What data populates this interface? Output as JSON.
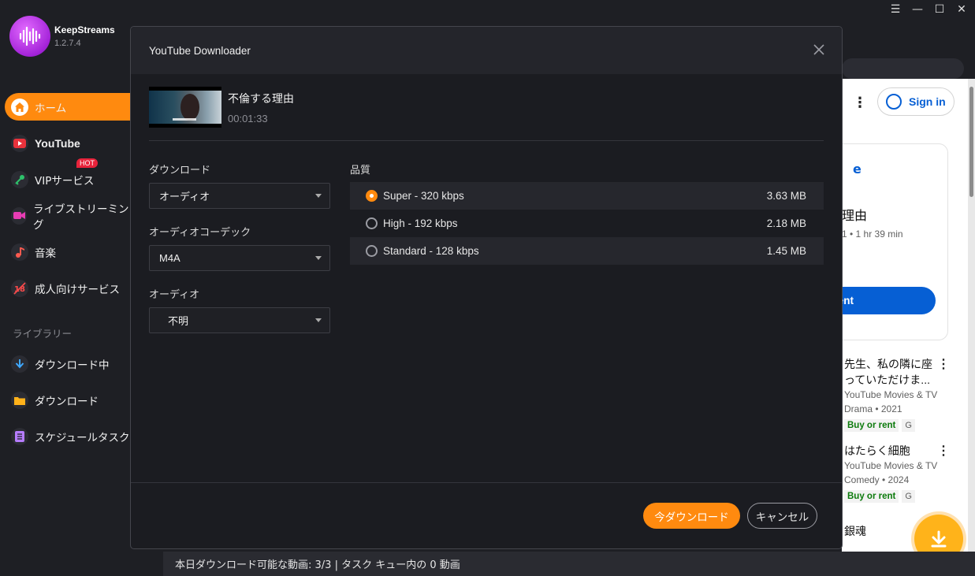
{
  "app": {
    "name": "KeepStreams",
    "version": "1.2.7.4"
  },
  "sidebar": {
    "items": [
      {
        "label": "ホーム",
        "icon": "home-icon"
      },
      {
        "label": "YouTube",
        "icon": "youtube-icon"
      },
      {
        "label": "VIPサービス",
        "icon": "key-icon",
        "badge": "HOT"
      },
      {
        "label": "ライブストリーミング",
        "icon": "video-camera-icon"
      },
      {
        "label": "音楽",
        "icon": "music-note-icon"
      },
      {
        "label": "成人向けサービス",
        "icon": "adult-icon"
      }
    ],
    "library_label": "ライブラリー",
    "library": [
      {
        "label": "ダウンロード中",
        "icon": "download-arrow-icon"
      },
      {
        "label": "ダウンロード",
        "icon": "folder-icon"
      },
      {
        "label": "スケジュールタスク",
        "icon": "schedule-list-icon"
      }
    ]
  },
  "dialog": {
    "title": "YouTube Downloader",
    "media": {
      "title": "不倫する理由",
      "duration": "00:01:33"
    },
    "download_label": "ダウンロード",
    "download_value": "オーディオ",
    "codec_label": "オーディオコーデック",
    "codec_value": "M4A",
    "audio_label": "オーディオ",
    "audio_value": "不明",
    "quality_label": "品質",
    "qualities": [
      {
        "label": "Super - 320 kbps",
        "size": "3.63 MB",
        "selected": true
      },
      {
        "label": "High - 192 kbps",
        "size": "2.18 MB",
        "selected": false
      },
      {
        "label": "Standard - 128 kbps",
        "size": "1.45 MB",
        "selected": false
      }
    ],
    "download_button": "今ダウンロード",
    "cancel_button": "キャンセル"
  },
  "web": {
    "sign_in": "Sign in",
    "card_letter": "e",
    "card_title": "理由",
    "card_meta": "1 • 1 hr 39 min",
    "rent_button": "ent",
    "movies": [
      {
        "title": "先生、私の隣に座っていただけま...",
        "channel": "YouTube Movies & TV",
        "meta": "Drama • 2021",
        "buy": "Buy or rent",
        "rating": "G"
      },
      {
        "title": "はたらく細胞",
        "channel": "YouTube Movies & TV",
        "meta": "Comedy • 2024",
        "buy": "Buy or rent",
        "rating": "G"
      },
      {
        "title": "銀魂",
        "channel": "",
        "meta": "",
        "buy": "",
        "rating": ""
      }
    ]
  },
  "statusbar": {
    "text": "本日ダウンロード可能な動画: 3/3 | タスク キュー内の 0 動画"
  },
  "colors": {
    "accent": "#ff8a0f",
    "bg": "#1e1f24",
    "dialog": "#1b1c21",
    "link": "#065fd4"
  }
}
